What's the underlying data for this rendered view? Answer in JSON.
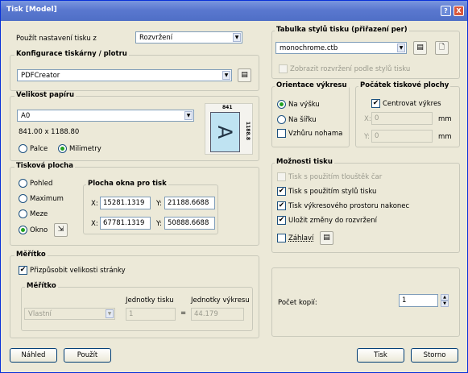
{
  "window": {
    "title": "Tisk [Model]",
    "help": "?",
    "close": "X"
  },
  "plot_settings": {
    "label": "Použít nastavení tisku z",
    "value": "Rozvržení"
  },
  "printer": {
    "title": "Konfigurace tiskárny / plotru",
    "value": "PDFCreator"
  },
  "paper": {
    "title": "Velikost papíru",
    "value": "A0",
    "dims": "841.00 x 1188.80",
    "width_label": "841",
    "height_label": "1188.8",
    "sheet_letter": "A",
    "units": [
      "Palce",
      "Milimetry"
    ]
  },
  "area": {
    "title": "Tisková plocha",
    "options": [
      "Pohled",
      "Maximum",
      "Meze",
      "Okno"
    ],
    "window_title": "Plocha okna pro tisk",
    "x_label": "X:",
    "y_label": "Y:",
    "x1": "15281.1319",
    "y1": "21188.6688",
    "x2": "67781.1319",
    "y2": "50888.6688"
  },
  "scale": {
    "title": "Měřítko",
    "fit_label": "Přizpůsobit velikosti stránky",
    "sub_title": "Měřítko",
    "paper_units": "Jednotky tisku",
    "drawing_units": "Jednotky výkresu",
    "value": "Vlastní",
    "paper_val": "1",
    "eq": "=",
    "drawing_val": "44.179"
  },
  "style": {
    "title": "Tabulka stylů tisku (přiřazení per)",
    "value": "monochrome.ctb",
    "show_label": "Zobrazit rozvržení podle stylů tisku"
  },
  "orient": {
    "title": "Orientace výkresu",
    "options": [
      "Na výšku",
      "Na šířku"
    ],
    "upside_label": "Vzhůru nohama"
  },
  "origin": {
    "title": "Počátek tiskové plochy",
    "center_label": "Centrovat výkres",
    "x_label": "X:",
    "y_label": "Y:",
    "x_val": "0",
    "y_val": "0",
    "unit": "mm"
  },
  "options": {
    "title": "Možnosti tisku",
    "items": [
      "Tisk s použitím tlouštěk čar",
      "Tisk s použitím stylů tisku",
      "Tisk výkresového prostoru nakonec",
      "Uložit změny do rozvržení",
      "Záhlaví"
    ]
  },
  "copies": {
    "label": "Počet kopií:",
    "value": "1"
  },
  "buttons": {
    "preview": "Náhled",
    "apply": "Použít",
    "print": "Tisk",
    "cancel": "Storno"
  },
  "colors": {
    "titlebar": "#5a78cf",
    "accent": "#21a121",
    "frame": "#ece9d8"
  },
  "icons": [
    "properties-icon",
    "new-icon",
    "select-window-icon"
  ]
}
